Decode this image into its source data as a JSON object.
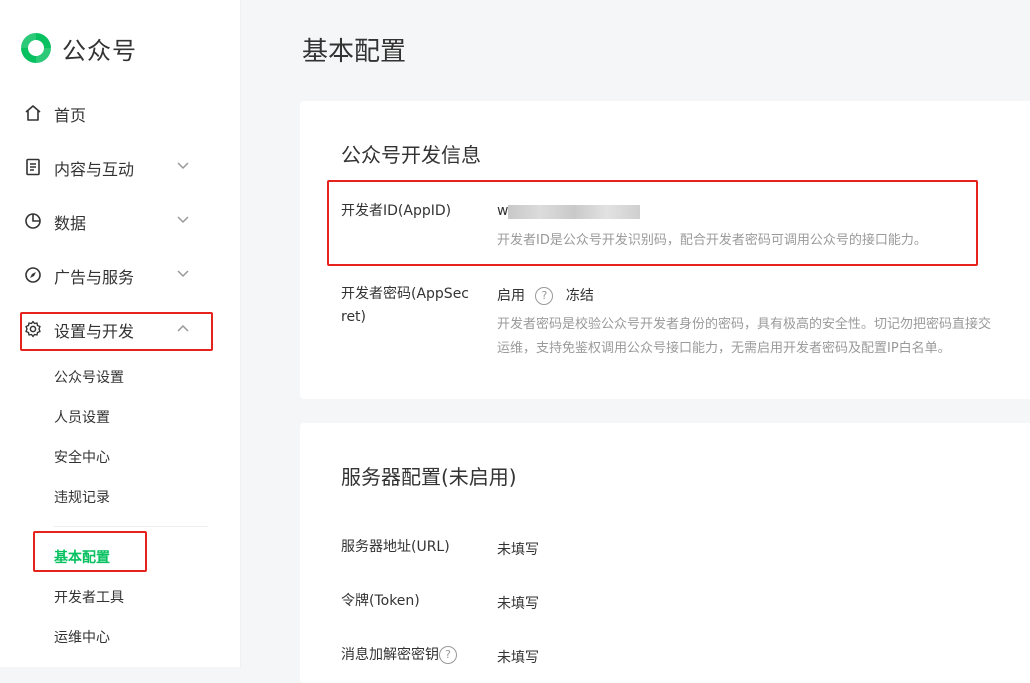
{
  "brand": {
    "name": "公众号",
    "logo_color": "#07c160"
  },
  "colors": {
    "accent": "#07c160",
    "highlight_box": "#e5231c"
  },
  "sidebar": {
    "items": [
      {
        "label": "首页",
        "icon": "home-icon"
      },
      {
        "label": "内容与互动",
        "icon": "document-icon"
      },
      {
        "label": "数据",
        "icon": "pie-chart-icon"
      },
      {
        "label": "广告与服务",
        "icon": "compass-icon"
      },
      {
        "label": "设置与开发",
        "icon": "gear-icon"
      }
    ],
    "subitems": [
      {
        "label": "公众号设置"
      },
      {
        "label": "人员设置"
      },
      {
        "label": "安全中心"
      },
      {
        "label": "违规记录"
      },
      {
        "label": "基本配置"
      },
      {
        "label": "开发者工具"
      },
      {
        "label": "运维中心"
      }
    ]
  },
  "page": {
    "title": "基本配置"
  },
  "dev_info": {
    "title": "公众号开发信息",
    "appid_label": "开发者ID(AppID)",
    "appid_value_prefix": "w",
    "appid_desc": "开发者ID是公众号开发识别码，配合开发者密码可调用公众号的接口能力。",
    "secret_label_line1": "开发者密码(AppSec",
    "secret_label_line2": "ret)",
    "secret_enable": "启用",
    "secret_help": "?",
    "secret_freeze": "冻结",
    "secret_desc_line1": "开发者密码是校验公众号开发者身份的密码，具有极高的安全性。切记勿把密码直接交",
    "secret_desc_line2": "运维，支持免鉴权调用公众号接口能力，无需启用开发者密码及配置IP白名单。"
  },
  "server_config": {
    "title": "服务器配置(未启用)",
    "url_label": "服务器地址(URL)",
    "url_value": "未填写",
    "token_label": "令牌(Token)",
    "token_value": "未填写",
    "aes_label": "消息加解密密钥",
    "aes_help": "?",
    "aes_value": "未填写"
  }
}
